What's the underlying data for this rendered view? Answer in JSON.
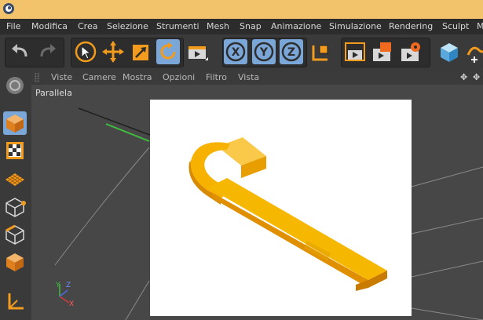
{
  "window": {
    "app_icon": "cinema4d-logo-icon"
  },
  "menubar": {
    "items": [
      "File",
      "Modifica",
      "Crea",
      "Selezione",
      "Strumenti",
      "Mesh",
      "Snap",
      "Animazione",
      "Simulazione",
      "Rendering",
      "Sculpt",
      "M"
    ]
  },
  "toolbar": {
    "buttons": [
      "undo-icon",
      "redo-icon",
      "live-selection-icon",
      "move-icon",
      "scale-icon",
      "rotate-icon",
      "recent-tools-icon",
      "x-axis-lock-icon",
      "y-axis-lock-icon",
      "z-axis-lock-icon",
      "coordinate-system-icon",
      "render-view-icon",
      "render-to-picture-viewer-icon",
      "render-settings-icon",
      "cube-primitive-icon",
      "spline-pen-icon"
    ],
    "axis_labels": {
      "x": "X",
      "y": "Y",
      "z": "Z"
    }
  },
  "sidebar": {
    "tools": [
      "make-editable-icon",
      "model-mode-icon",
      "texture-mode-icon",
      "workplane-icon",
      "points-mode-icon",
      "edges-mode-icon",
      "polygons-mode-icon",
      "axis-mode-icon"
    ]
  },
  "viewport_menu": {
    "items": [
      "Viste",
      "Camere",
      "Mostra",
      "Opzioni",
      "Filtro",
      "Vista"
    ]
  },
  "viewport": {
    "label": "Parallela",
    "axis_gizmo": {
      "x": "X",
      "y": "Y",
      "z": "Z"
    },
    "object_color": "#f4b200",
    "render_background": "#ffffff"
  },
  "colors": {
    "titlebar": "#f2c36a",
    "menubar": "#2c2c2c",
    "toolbar": "#3a3a3a",
    "active_tool": "#7aa6d8",
    "accent_orange": "#f29b1d",
    "viewport_bg": "#474747"
  }
}
